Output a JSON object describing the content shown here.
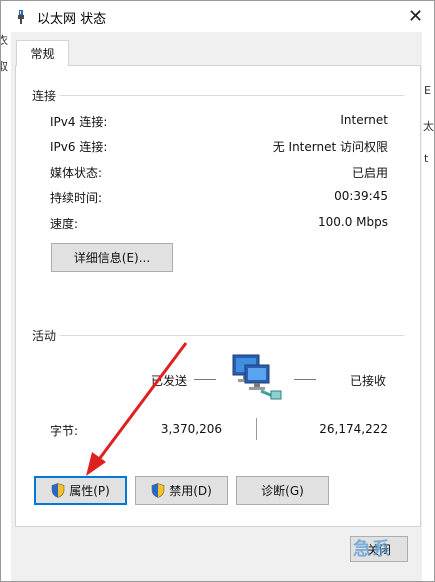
{
  "window": {
    "title": "以太网 状态"
  },
  "background": {
    "left_fragments": [
      "衣",
      "取"
    ],
    "right_fragments": [
      "E",
      "太",
      "t"
    ]
  },
  "tabs": [
    {
      "label": "常规"
    }
  ],
  "connection": {
    "group_label": "连接",
    "rows": [
      {
        "label": "IPv4 连接:",
        "value": "Internet"
      },
      {
        "label": "IPv6 连接:",
        "value": "无 Internet 访问权限"
      },
      {
        "label": "媒体状态:",
        "value": "已启用"
      },
      {
        "label": "持续时间:",
        "value": "00:39:45"
      },
      {
        "label": "速度:",
        "value": "100.0 Mbps"
      }
    ],
    "details_button": "详细信息(E)..."
  },
  "activity": {
    "group_label": "活动",
    "sent_label": "已发送",
    "received_label": "已接收",
    "bytes_label": "字节:",
    "bytes_sent": "3,370,206",
    "bytes_received": "26,174,222"
  },
  "buttons": {
    "properties": "属性(P)",
    "disable": "禁用(D)",
    "diagnose": "诊断(G)",
    "close": "关闭"
  },
  "watermark": "急系",
  "colors": {
    "accent": "#0078d7",
    "arrow": "#e02020"
  },
  "icons": {
    "title": "network-cable-icon",
    "activity": "network-computers-icon",
    "shield": "uac-shield-icon",
    "close": "close-icon"
  }
}
